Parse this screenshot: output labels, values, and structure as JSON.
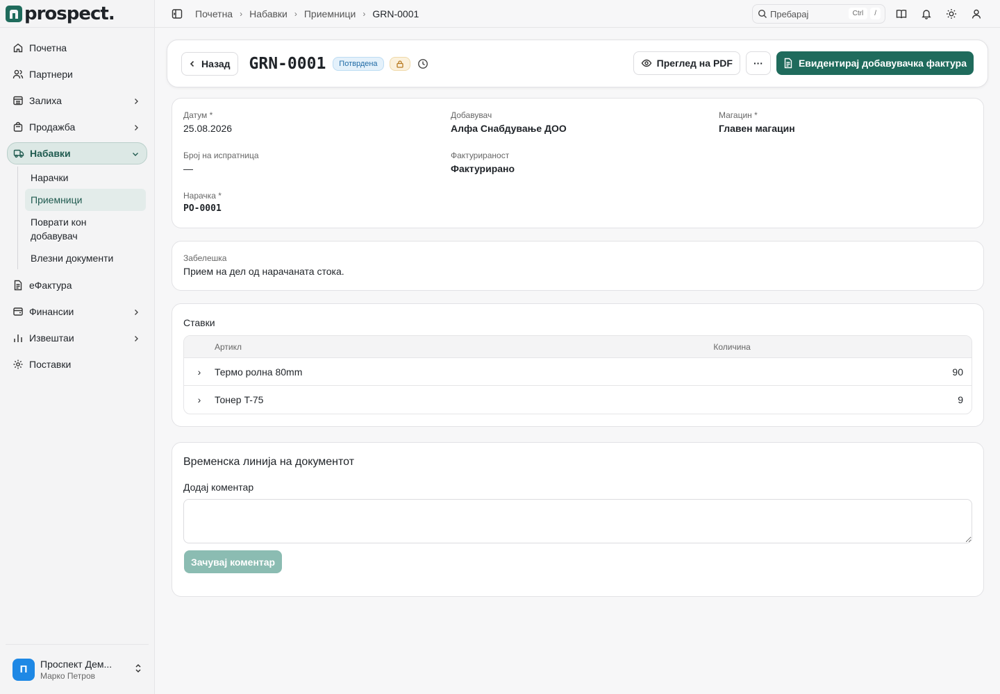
{
  "brand": {
    "name": "prospect."
  },
  "sidebar": {
    "items": [
      {
        "label": "Почетна",
        "icon": "home-icon"
      },
      {
        "label": "Партнери",
        "icon": "users-icon"
      },
      {
        "label": "Залиха",
        "icon": "inventory-icon"
      },
      {
        "label": "Продажба",
        "icon": "shopping-bag-icon"
      },
      {
        "label": "Набавки",
        "icon": "truck-icon"
      },
      {
        "label": "еФактура",
        "icon": "document-icon"
      },
      {
        "label": "Финансии",
        "icon": "wallet-icon"
      },
      {
        "label": "Извештаи",
        "icon": "bar-chart-icon"
      },
      {
        "label": "Поставки",
        "icon": "gear-icon"
      }
    ],
    "sub_items": [
      "Нарачки",
      "Приемници",
      "Поврати кон добавувач",
      "Влезни документи"
    ]
  },
  "user": {
    "initial": "П",
    "name": "Проспект Дем...",
    "sub": "Марко Петров"
  },
  "breadcrumb": [
    "Почетна",
    "Набавки",
    "Приемници",
    "GRN-0001"
  ],
  "search": {
    "placeholder": "Пребарај",
    "kbd1": "Ctrl",
    "kbd2": "/"
  },
  "header": {
    "back_label": "Назад",
    "title": "GRN-0001",
    "status": "Потврдена",
    "pdf_label": "Преглед на PDF",
    "more_label": "···",
    "primary_label": "Евидентирај добавувачка фактура"
  },
  "details": {
    "date_label": "Датум *",
    "date_value": "25.08.2026",
    "supplier_label": "Добавувач",
    "supplier_value": "Алфа Снабдување ДОО",
    "warehouse_label": "Магацин *",
    "warehouse_value": "Главен магацин",
    "delivery_label": "Број на испратница",
    "delivery_value": "—",
    "invoicing_label": "Фактурираност",
    "invoicing_value": "Фактурирано",
    "order_label": "Нарачка *",
    "order_value": "PO-0001"
  },
  "note": {
    "label": "Забелешка",
    "value": "Прием на дел од нарачаната стока."
  },
  "items": {
    "title": "Ставки",
    "col_item": "Артикл",
    "col_qty": "Количина",
    "rows": [
      {
        "name": "Термо ролна 80mm",
        "qty": "90"
      },
      {
        "name": "Тонер T-75",
        "qty": "9"
      }
    ]
  },
  "timeline": {
    "title": "Временска линија на документот",
    "comment_label": "Додај коментар",
    "comment_value": "",
    "save_label": "Зачувај коментар"
  },
  "colors": {
    "primary": "#1f6b5c",
    "primary_disabled": "#8bbcb2",
    "status_badge": "#1f6aa5"
  }
}
